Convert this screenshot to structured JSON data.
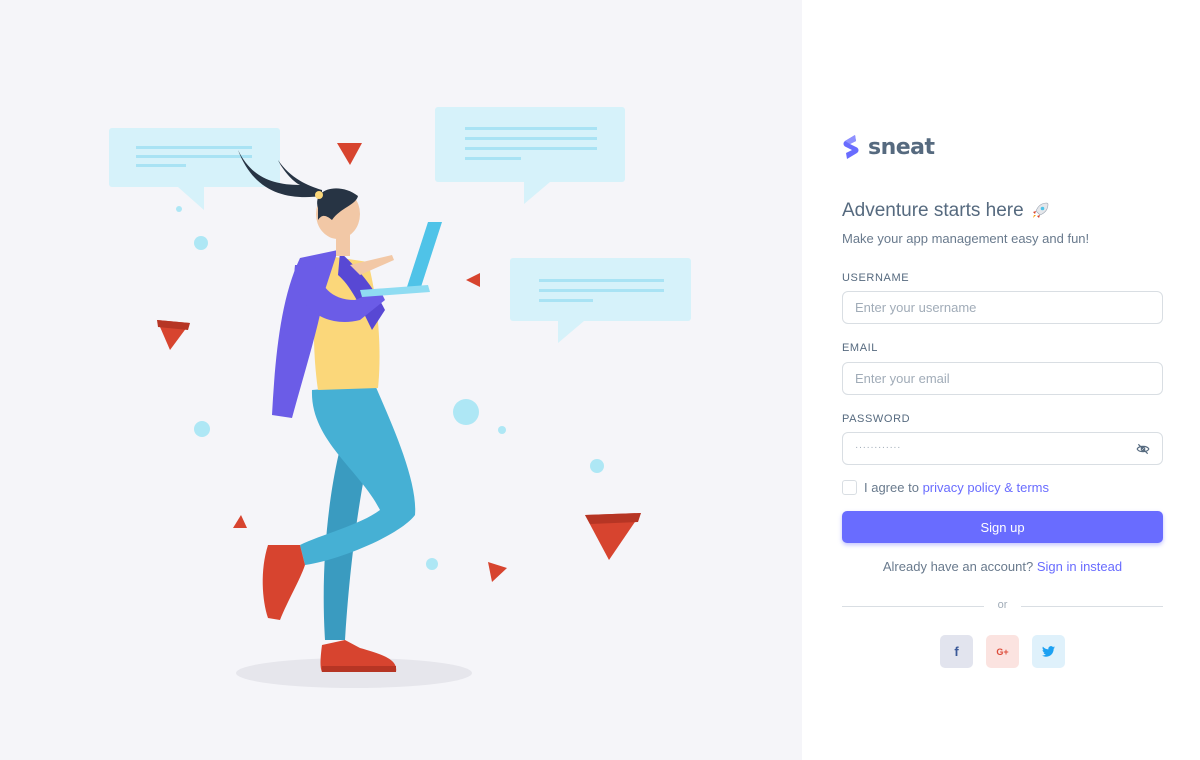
{
  "brand": {
    "name": "sneat",
    "logo_icon": "sneat-logo-icon",
    "color": "#696cff"
  },
  "form": {
    "title": "Adventure starts here",
    "title_emoji": "rocket-icon",
    "subtitle": "Make your app management easy and fun!",
    "username": {
      "label": "USERNAME",
      "placeholder": "Enter your username",
      "value": ""
    },
    "email": {
      "label": "EMAIL",
      "placeholder": "Enter your email",
      "value": ""
    },
    "password": {
      "label": "PASSWORD",
      "masked": "············",
      "toggle_icon": "eye-off-icon"
    },
    "agree": {
      "prefix": "I agree to ",
      "link": "privacy policy & terms",
      "checked": false
    },
    "submit_label": "Sign up",
    "signin": {
      "prompt": "Already have an account?",
      "link": "Sign in instead"
    },
    "divider": "or",
    "socials": [
      {
        "name": "facebook",
        "icon": "facebook-icon",
        "glyph": "f"
      },
      {
        "name": "google-plus",
        "icon": "google-plus-icon",
        "glyph": "G+"
      },
      {
        "name": "twitter",
        "icon": "twitter-icon"
      }
    ]
  },
  "colors": {
    "primary": "#696cff",
    "text": "#566a7f",
    "muted": "#a1acb8",
    "bg_left": "#f5f5f9",
    "border": "#d9dee3"
  }
}
